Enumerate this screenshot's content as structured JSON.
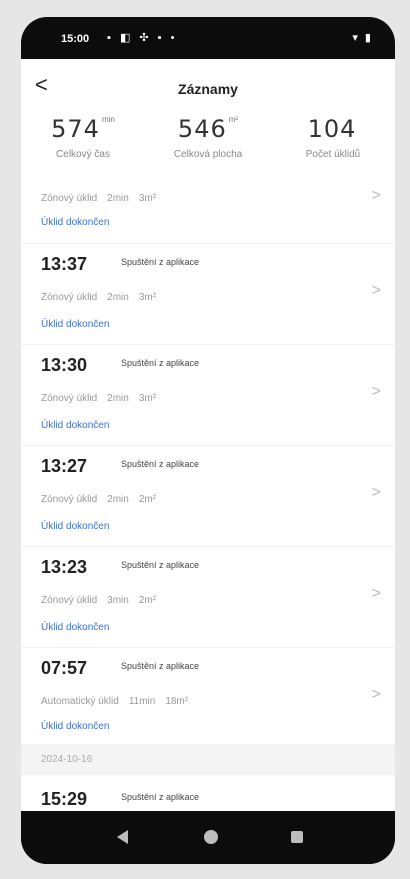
{
  "status_bar": {
    "time": "15:00",
    "left_icons": "▪ ◧ ✣ ▪ •",
    "right_icons": "▾ ▮"
  },
  "header": {
    "back": "<",
    "title": "Záznamy"
  },
  "stats": [
    {
      "value": "574",
      "unit": "min",
      "label": "Celkový čas"
    },
    {
      "value": "546",
      "unit": "m²",
      "label": "Celková plocha"
    },
    {
      "value": "104",
      "unit": "",
      "label": "Počet úklidů"
    }
  ],
  "records_top": {
    "type": "Zónový úklid",
    "duration": "2min",
    "area": "3m²",
    "status": "Úklid dokončen"
  },
  "records": [
    {
      "time": "13:37",
      "source": "Spuštění z aplikace",
      "type": "Zónový úklid",
      "duration": "2min",
      "area": "3m²",
      "status": "Úklid dokončen"
    },
    {
      "time": "13:30",
      "source": "Spuštění z aplikace",
      "type": "Zónový úklid",
      "duration": "2min",
      "area": "3m²",
      "status": "Úklid dokončen"
    },
    {
      "time": "13:27",
      "source": "Spuštění z aplikace",
      "type": "Zónový úklid",
      "duration": "2min",
      "area": "2m²",
      "status": "Úklid dokončen"
    },
    {
      "time": "13:23",
      "source": "Spuštění z aplikace",
      "type": "Zónový úklid",
      "duration": "3min",
      "area": "2m²",
      "status": "Úklid dokončen"
    },
    {
      "time": "07:57",
      "source": "Spuštění z aplikace",
      "type": "Automatický úklid",
      "duration": "11min",
      "area": "18m²",
      "status": "Úklid dokončen"
    }
  ],
  "date_band": "2024-10-16",
  "next_record": {
    "time": "15:29",
    "source": "Spuštění z aplikace"
  },
  "chevron": ">"
}
